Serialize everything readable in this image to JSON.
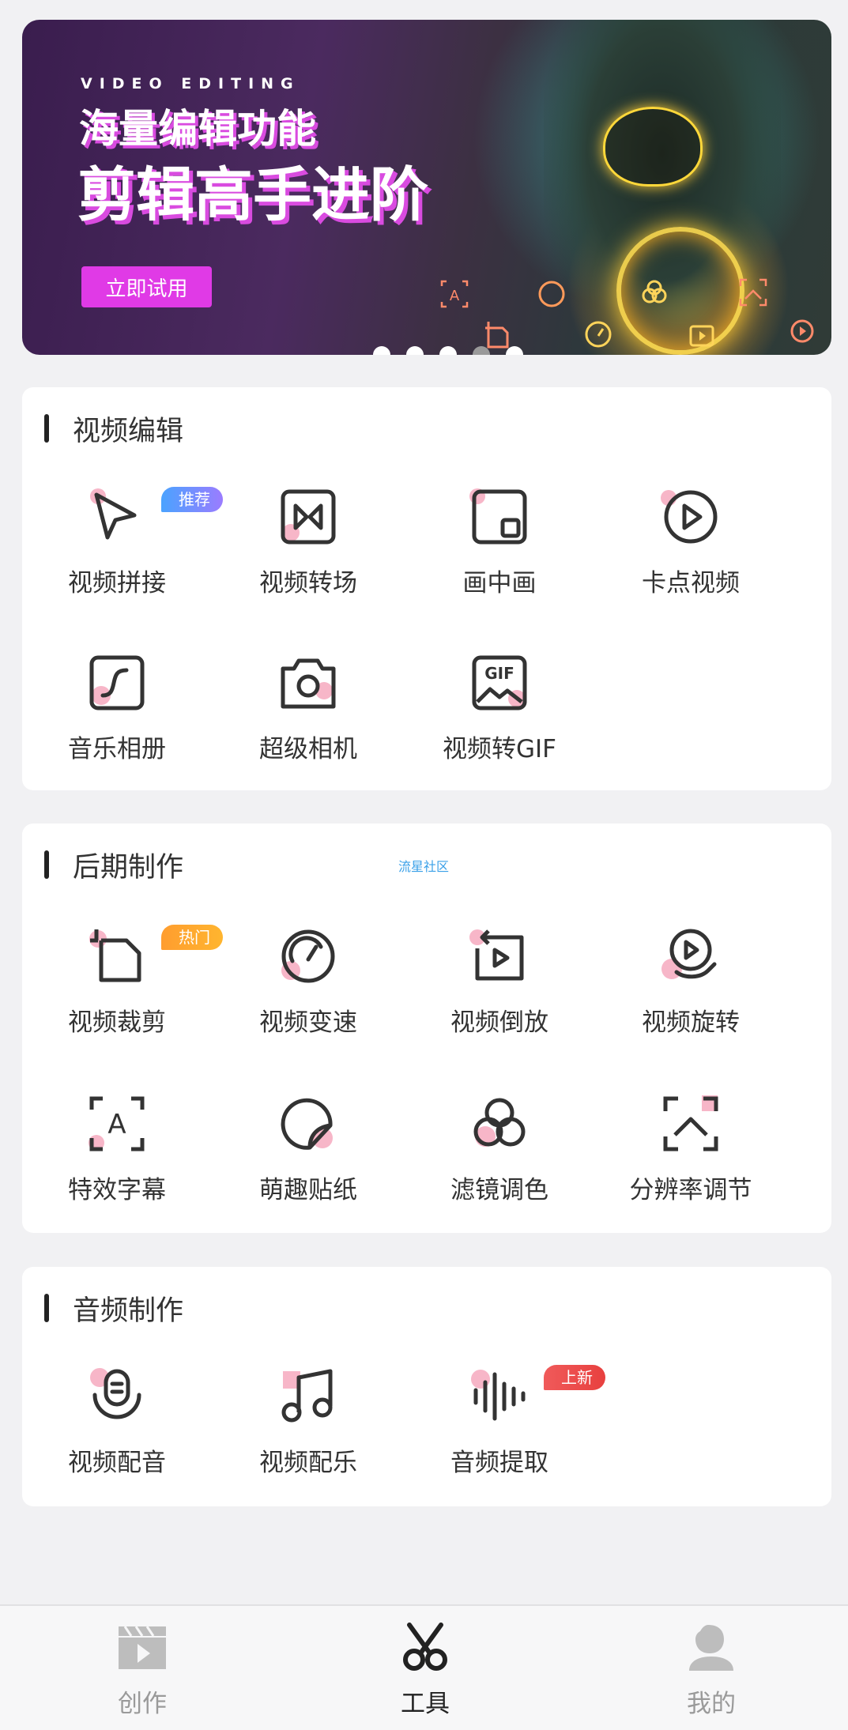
{
  "banner": {
    "subtitle_en": "VIDEO EDITING",
    "title_line1": "海量编辑功能",
    "title_line2": "剪辑高手进阶",
    "cta_label": "立即试用",
    "carousel_total": 5,
    "carousel_active": 4
  },
  "sections": {
    "video_edit": {
      "title": "视频编辑",
      "items": [
        {
          "label": "视频拼接",
          "icon": "play-cursor-icon",
          "badge": "推荐"
        },
        {
          "label": "视频转场",
          "icon": "transition-icon"
        },
        {
          "label": "画中画",
          "icon": "picture-in-picture-icon"
        },
        {
          "label": "卡点视频",
          "icon": "play-circle-icon"
        },
        {
          "label": "音乐相册",
          "icon": "music-album-icon"
        },
        {
          "label": "超级相机",
          "icon": "camera-icon"
        },
        {
          "label": "视频转GIF",
          "icon": "gif-icon"
        }
      ]
    },
    "post_production": {
      "title": "后期制作",
      "watermark": "流星社区",
      "items": [
        {
          "label": "视频裁剪",
          "icon": "crop-icon",
          "badge": "热门"
        },
        {
          "label": "视频变速",
          "icon": "speedometer-icon"
        },
        {
          "label": "视频倒放",
          "icon": "reverse-play-icon"
        },
        {
          "label": "视频旋转",
          "icon": "rotate-icon"
        },
        {
          "label": "特效字幕",
          "icon": "subtitle-icon"
        },
        {
          "label": "萌趣贴纸",
          "icon": "sticker-icon"
        },
        {
          "label": "滤镜调色",
          "icon": "filter-icon"
        },
        {
          "label": "分辨率调节",
          "icon": "resolution-icon"
        }
      ]
    },
    "audio": {
      "title": "音频制作",
      "items": [
        {
          "label": "视频配音",
          "icon": "microphone-icon"
        },
        {
          "label": "视频配乐",
          "icon": "music-note-icon"
        },
        {
          "label": "音频提取",
          "icon": "waveform-icon",
          "badge": "上新"
        }
      ]
    }
  },
  "nav": {
    "items": [
      {
        "label": "创作",
        "icon": "clapperboard-icon"
      },
      {
        "label": "工具",
        "icon": "scissors-icon",
        "active": true
      },
      {
        "label": "我的",
        "icon": "user-icon"
      }
    ]
  },
  "colors": {
    "accent_pink": "#f7b6c8",
    "banner_cta": "#e03ae6",
    "icon_stroke": "#333333"
  }
}
